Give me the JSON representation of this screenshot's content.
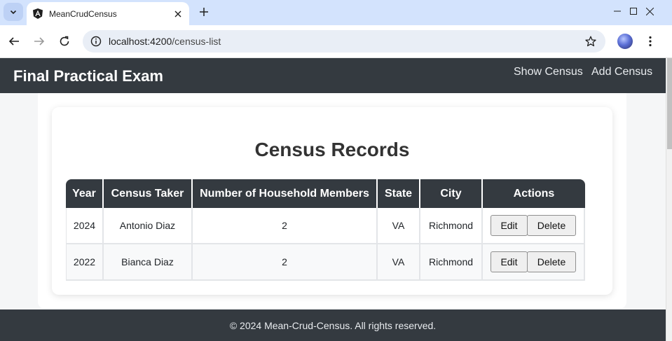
{
  "browser": {
    "tab_title": "MeanCrudCensus",
    "url_host": "localhost:4200",
    "url_path": "/census-list"
  },
  "navbar": {
    "brand": "Final Practical Exam",
    "links": [
      "Show Census",
      "Add Census"
    ]
  },
  "main": {
    "title": "Census Records",
    "table": {
      "headers": [
        "Year",
        "Census Taker",
        "Number of Household Members",
        "State",
        "City",
        "Actions"
      ],
      "rows": [
        {
          "year": "2024",
          "taker": "Antonio Diaz",
          "members": "2",
          "state": "VA",
          "city": "Richmond"
        },
        {
          "year": "2022",
          "taker": "Bianca Diaz",
          "members": "2",
          "state": "VA",
          "city": "Richmond"
        }
      ],
      "edit_label": "Edit",
      "delete_label": "Delete"
    }
  },
  "footer": {
    "text": "© 2024 Mean-Crud-Census. All rights reserved."
  },
  "colors": {
    "navbar_bg": "#343a40",
    "page_bg": "#f5f6f7",
    "tabstrip_bg": "#d3e3fd"
  }
}
